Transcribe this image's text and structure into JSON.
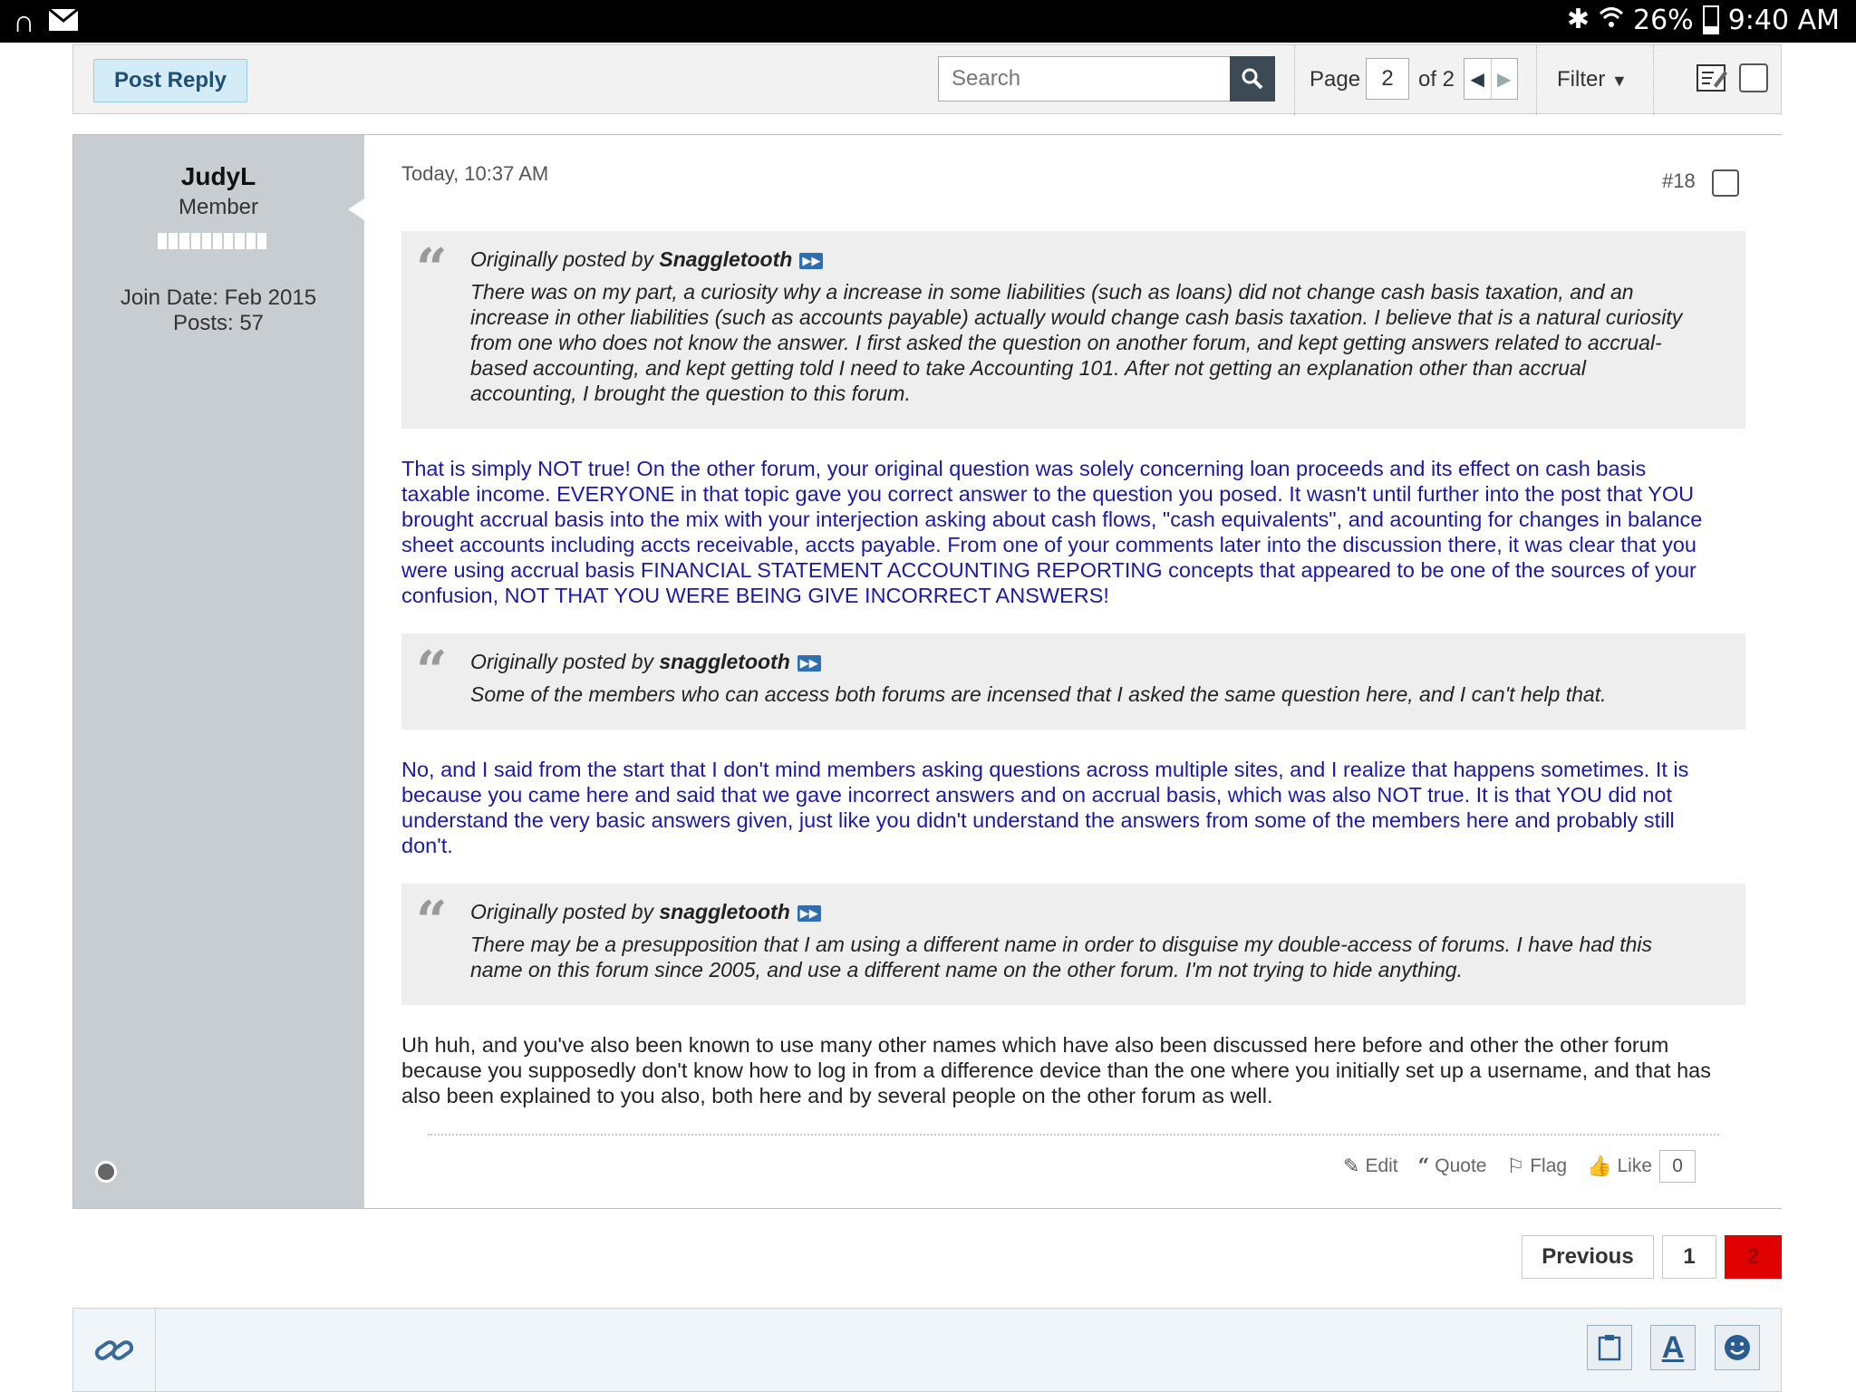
{
  "status_bar": {
    "battery": "26%",
    "time": "9:40 AM"
  },
  "toolbar": {
    "post_reply": "Post Reply",
    "search_placeholder": "Search",
    "page_label": "Page",
    "page_value": "2",
    "of_label": "of 2",
    "filter_label": "Filter"
  },
  "user": {
    "name": "JudyL",
    "title": "Member",
    "join_date": "Join Date: Feb 2015",
    "posts": "Posts: 57"
  },
  "post": {
    "timestamp": "Today, 10:37 AM",
    "number": "#18",
    "quotes": [
      {
        "prefix": "Originally posted by",
        "author": "Snaggletooth",
        "lines": [
          "There was on my part, a curiosity why a increase in some liabilities (such as loans) did not change cash basis taxation, and an",
          "increase in other liabilities (such as accounts payable) actually would change cash basis taxation. I believe that is a natural curiosity",
          "from one who does not know the answer. I first asked the question on another forum, and kept getting answers related to accrual-",
          "based accounting, and kept getting told I need to take Accounting 101. After not getting an explanation other than accrual",
          "accounting, I brought the question to this forum."
        ]
      },
      {
        "prefix": "Originally posted by",
        "author": "snaggletooth",
        "lines": [
          "Some of the members who can access both forums are incensed that I asked the same question here, and I can't help that."
        ]
      },
      {
        "prefix": "Originally posted by",
        "author": "snaggletooth",
        "lines": [
          "There may be a presupposition that I am using a different name in order to disguise my double-access of forums. I have had this",
          "name on this forum since 2005, and use a different name on the other forum. I'm not trying to hide anything."
        ]
      }
    ],
    "replies": [
      {
        "lines": [
          "That is simply NOT true! On the other forum, your original question was solely concerning loan proceeds and its effect on cash basis",
          "taxable income. EVERYONE in that topic gave you correct answer to the question you posed. It wasn't until further into the post that YOU",
          "brought accrual basis into the mix with your interjection asking about cash flows, \"cash equivalents\", and acounting for changes in balance",
          "sheet accounts including accts receivable, accts payable. From one of your comments later into the discussion there, it was clear that you",
          "were using accrual basis FINANCIAL STATEMENT ACCOUNTING REPORTING concepts that appeared to be one of the sources of your",
          "confusion, NOT THAT YOU WERE BEING GIVE INCORRECT ANSWERS!"
        ]
      },
      {
        "lines": [
          "No, and I said from the start that I don't mind members asking questions across multiple sites, and I realize that happens sometimes. It is",
          "because you came here and said that we gave incorrect answers and on accrual basis, which was also NOT true. It is that YOU did not",
          "understand the very basic answers given, just like you didn't understand the answers from some of the members here and probably still",
          "don't."
        ]
      },
      {
        "lines": [
          "Uh huh, and you've also been known to use many other names which have also been discussed here before and other the other forum",
          "because you supposedly don't know how to log in from a difference device than the one where you initially set up a username, and that has",
          "also been explained to you also, both here and by several people on the other forum as well."
        ]
      }
    ],
    "actions": {
      "edit": "Edit",
      "quote": "Quote",
      "flag": "Flag",
      "like": "Like",
      "like_count": "0"
    }
  },
  "pagination": {
    "previous": "Previous",
    "page1": "1",
    "page2": "2"
  },
  "colors": {
    "reply_text": "#1a1aa8",
    "active_page": "#e00000",
    "sidebar": "#c8cdd1"
  },
  "icons": [
    "app-logo-icon",
    "mail-icon",
    "bluetooth-icon",
    "wifi-icon",
    "battery-icon",
    "search-icon",
    "edit-post-icon",
    "quote-mark-icon",
    "view-post-icon",
    "pencil-icon",
    "quote-icon",
    "flag-icon",
    "thumbs-up-icon",
    "link-icon",
    "clipboard-icon",
    "font-color-icon",
    "smiley-icon"
  ]
}
